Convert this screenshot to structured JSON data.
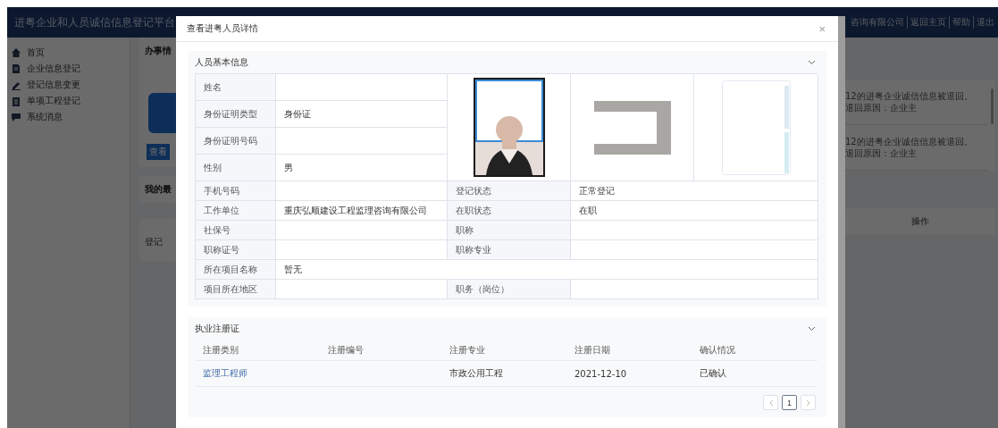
{
  "header": {
    "title": "进粤企业和人员诚信信息登记平台",
    "links": [
      "咨询有限公司",
      "返回主页",
      "帮助",
      "退出"
    ]
  },
  "sidebar": {
    "items": [
      {
        "label": "首页"
      },
      {
        "label": "企业信息登记"
      },
      {
        "label": "登记信息变更"
      },
      {
        "label": "单项工程登记"
      },
      {
        "label": "系统消息"
      }
    ]
  },
  "background": {
    "card_title": "办事情",
    "button": "查看",
    "recent_title": "我的最",
    "table_column": "登记",
    "messages": [
      "12的进粤企业诚信信息被退回。退回原因：企业主",
      "12的进粤企业诚信信息被退回。退回原因：企业主"
    ],
    "action_column": "操作"
  },
  "dialog": {
    "title": "查看进粤人员详情",
    "close": "×",
    "basic_info": {
      "title": "人员基本信息",
      "expanded": true,
      "fields": [
        {
          "label": "姓名"
        },
        {
          "label": "身份证明类型",
          "value": "身份证"
        },
        {
          "label": "身份证明号码"
        },
        {
          "label": "性别",
          "value": "男"
        }
      ],
      "photos": [
        {
          "kind": "portrait"
        },
        {
          "kind": "frame"
        },
        {
          "kind": "blank"
        }
      ],
      "rows": [
        [
          {
            "label": "手机号码"
          },
          {
            "label": "登记状态",
            "value": "正常登记"
          }
        ],
        [
          {
            "label": "工作单位",
            "value": "重庆弘顺建设工程监理咨询有限公司"
          },
          {
            "label": "在职状态",
            "value": "在职"
          }
        ],
        [
          {
            "label": "社保号"
          },
          {
            "label": "职称"
          }
        ],
        [
          {
            "label": "职称证号"
          },
          {
            "label": "职称专业"
          }
        ],
        [
          {
            "label": "所在项目名称",
            "value": "暂无"
          }
        ],
        [
          {
            "label": "项目所在地区"
          },
          {
            "label": "职务（岗位）"
          }
        ]
      ]
    },
    "registration": {
      "title": "执业注册证",
      "expanded": true,
      "columns": [
        "注册类别",
        "注册编号",
        "注册专业",
        "注册日期",
        "确认情况"
      ],
      "rows": [
        [
          {
            "kind": "link",
            "text": "监理工程师"
          },
          {
            "kind": "blank"
          },
          {
            "kind": "text",
            "text": "市政公用工程"
          },
          {
            "kind": "text",
            "text": "2021-12-10"
          },
          {
            "kind": "text",
            "text": "已确认"
          }
        ]
      ],
      "pages": [
        {
          "label": "1",
          "selected": true
        }
      ]
    }
  }
}
